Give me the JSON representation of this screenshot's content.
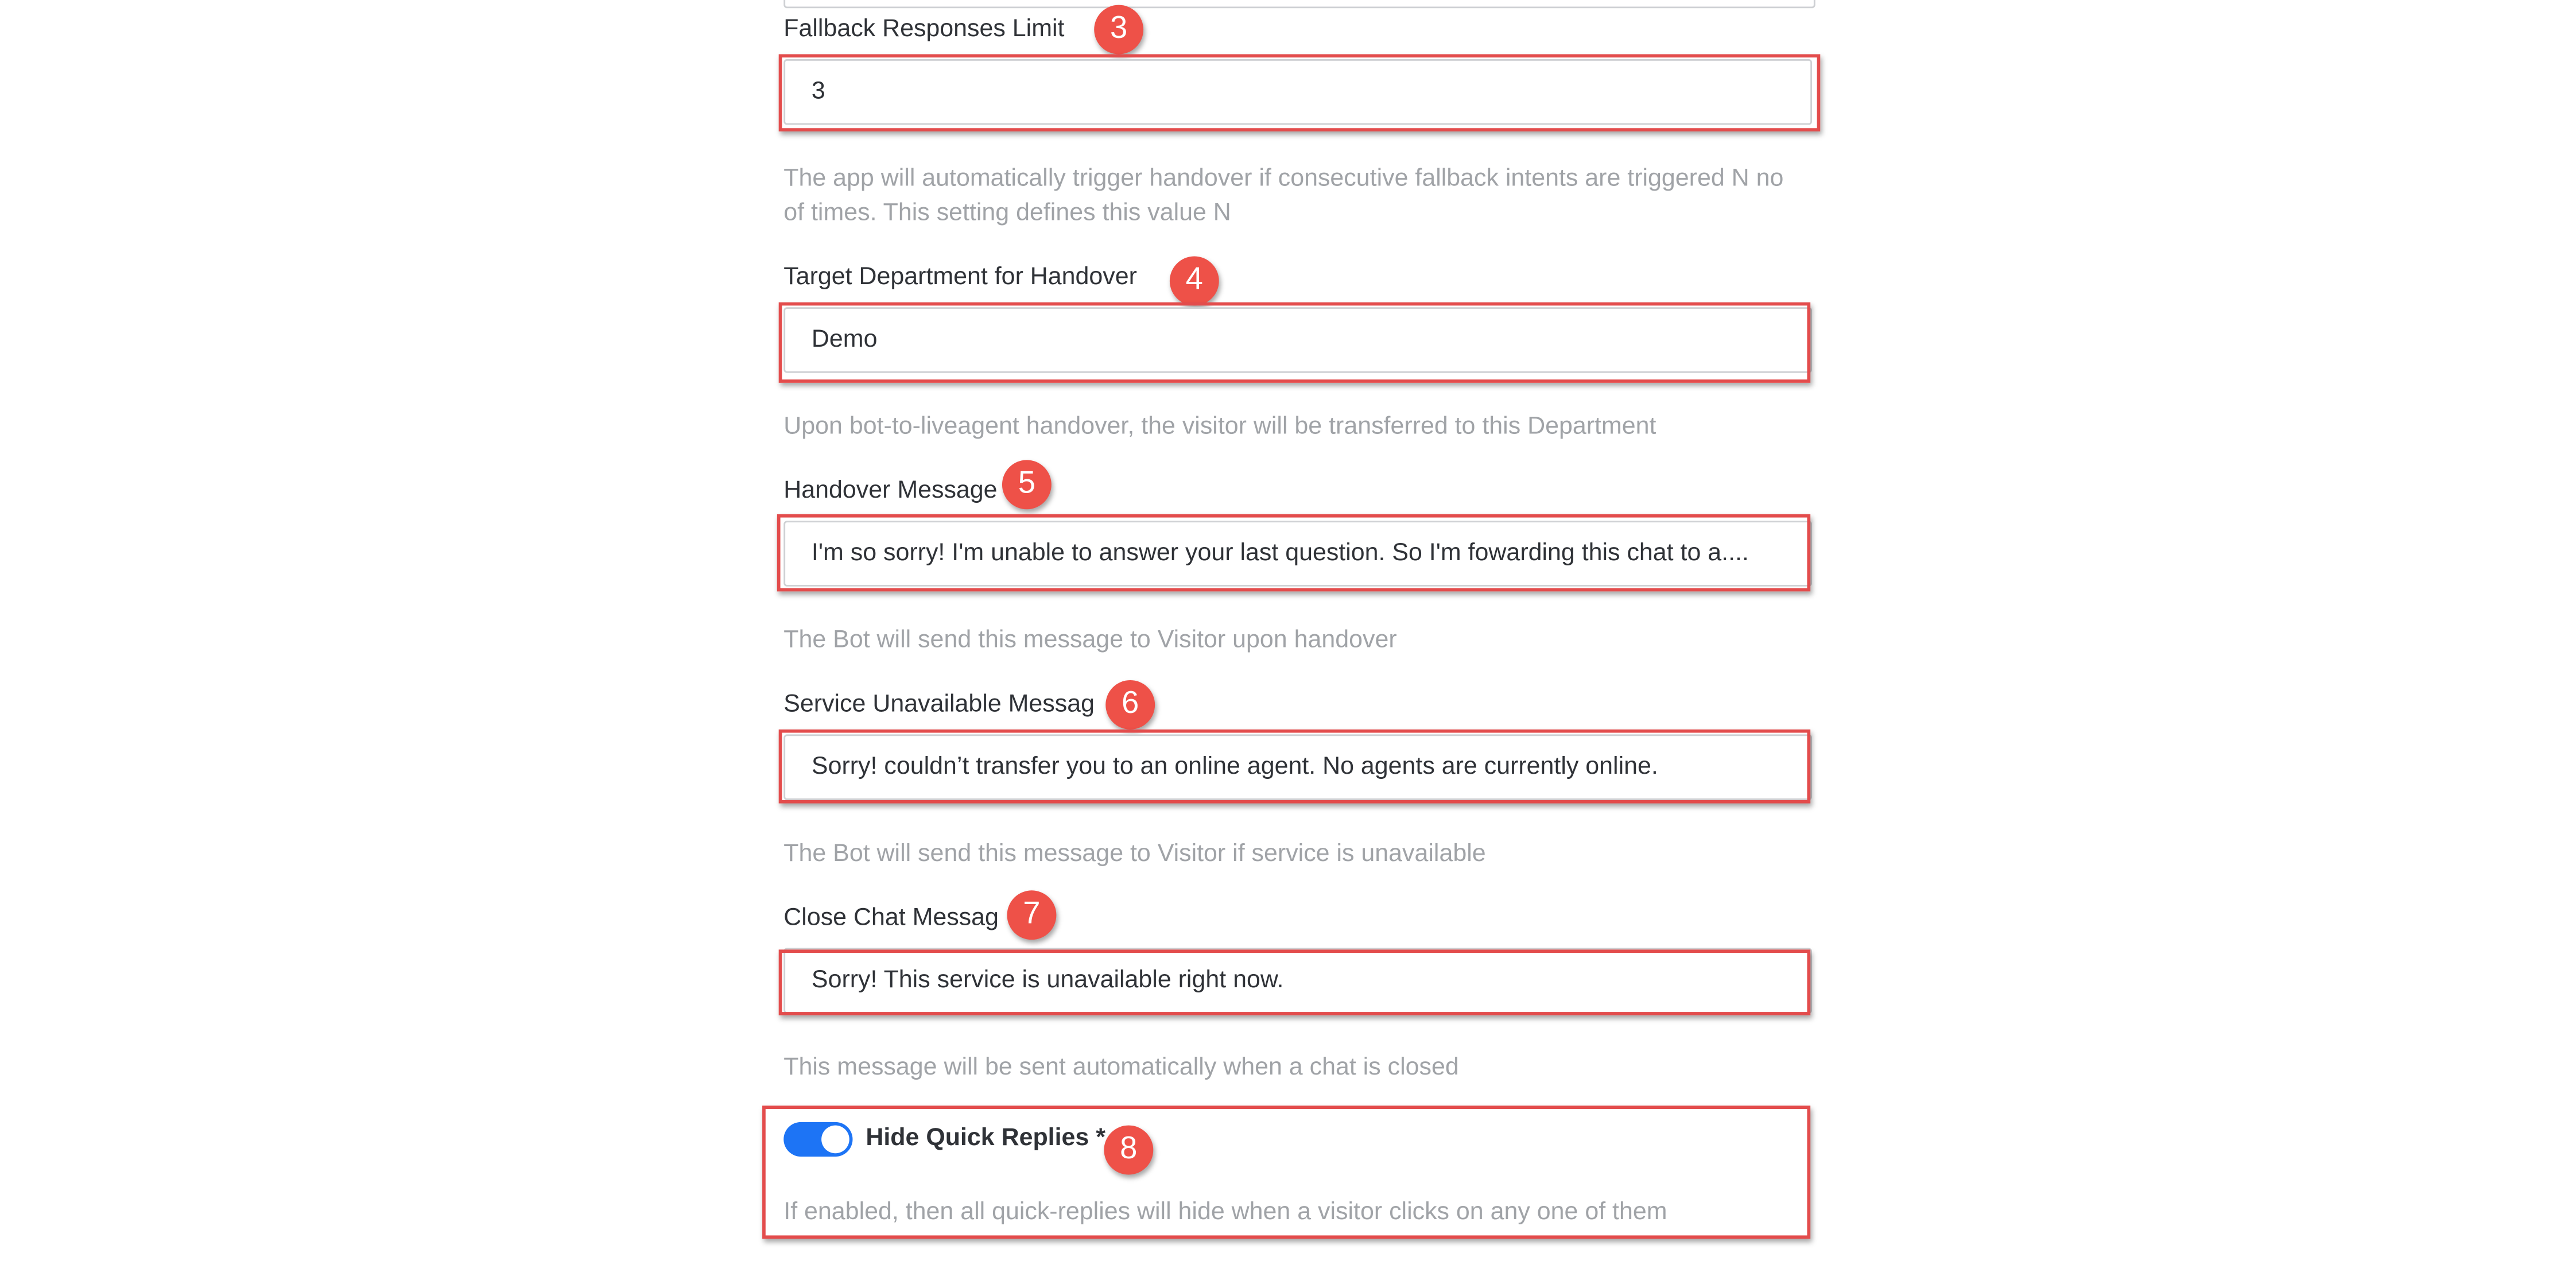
{
  "fallback_limit": {
    "label": "Fallback Responses Limit",
    "value": "3",
    "help": "The app will automatically trigger handover if consecutive fallback intents are triggered N no of times. This setting defines this value N",
    "badge": "3"
  },
  "target_department": {
    "label": "Target Department for Handover",
    "value": "Demo",
    "help": "Upon bot-to-liveagent handover, the visitor will be transferred to this Department",
    "badge": "4"
  },
  "handover_message": {
    "label": "Handover Message",
    "value": "I'm so sorry! I'm unable to answer your last question. So I'm fowarding this chat to a....",
    "help": "The Bot will send this message to Visitor upon handover",
    "badge": "5"
  },
  "service_unavailable_message": {
    "label": "Service Unavailable Messag",
    "value": "Sorry! couldn’t transfer you to an online agent. No agents are currently online.",
    "help": "The Bot will send this message to Visitor if service is unavailable",
    "badge": "6"
  },
  "close_chat_message": {
    "label": "Close Chat Messag",
    "value": "Sorry! This service is unavailable right now.",
    "help": "This message will be sent automatically when a chat is closed",
    "badge": "7"
  },
  "hide_quick_replies": {
    "label": "Hide Quick Replies *",
    "enabled": true,
    "help": "If enabled, then all quick-replies will hide when a visitor clicks on any one of them",
    "badge": "8"
  },
  "colors": {
    "highlight": "#e34c4c",
    "badge": "#ee5148",
    "toggle_on": "#1d74f5",
    "help_text": "#a0a3a7"
  }
}
